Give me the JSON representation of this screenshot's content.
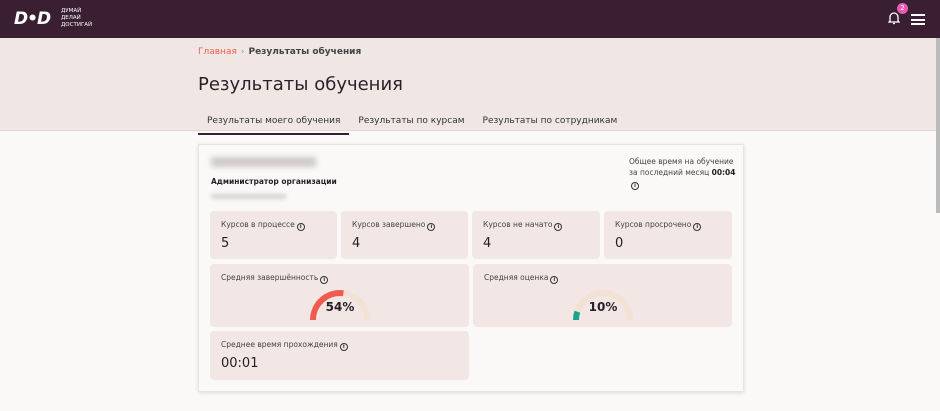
{
  "header": {
    "logo": "D•D",
    "slogan": [
      "ДУМАЙ",
      "ДЕЛАЙ",
      "ДОСТИГАЙ"
    ],
    "notifications": "2"
  },
  "breadcrumb": {
    "home": "Главная",
    "separator": "›",
    "current": "Результаты обучения"
  },
  "title": "Результаты обучения",
  "tabs": [
    {
      "label": "Результаты моего обучения",
      "active": true
    },
    {
      "label": "Результаты по курсам"
    },
    {
      "label": "Результаты по сотрудникам"
    }
  ],
  "profile": {
    "role": "Администратор организации",
    "total_label": "Общее время на обучение за последний месяц",
    "total_value": "00:04"
  },
  "stats": [
    {
      "label": "Курсов в процессе",
      "value": "5"
    },
    {
      "label": "Курсов завершено",
      "value": "4"
    },
    {
      "label": "Курсов не начато",
      "value": "4"
    },
    {
      "label": "Курсов просрочено",
      "value": "0"
    }
  ],
  "gauges": [
    {
      "label": "Средняя завершённость",
      "value": "54%",
      "percent": 54,
      "color": "#f05a4f"
    },
    {
      "label": "Средняя оценка",
      "value": "10%",
      "percent": 10,
      "color": "#1aa38a"
    }
  ],
  "avg_time": {
    "label": "Среднее время прохождения",
    "value": "00:01"
  },
  "colors": {
    "header": "#3a1f33",
    "accent": "#e8604f",
    "track": "#f1e2d3"
  }
}
